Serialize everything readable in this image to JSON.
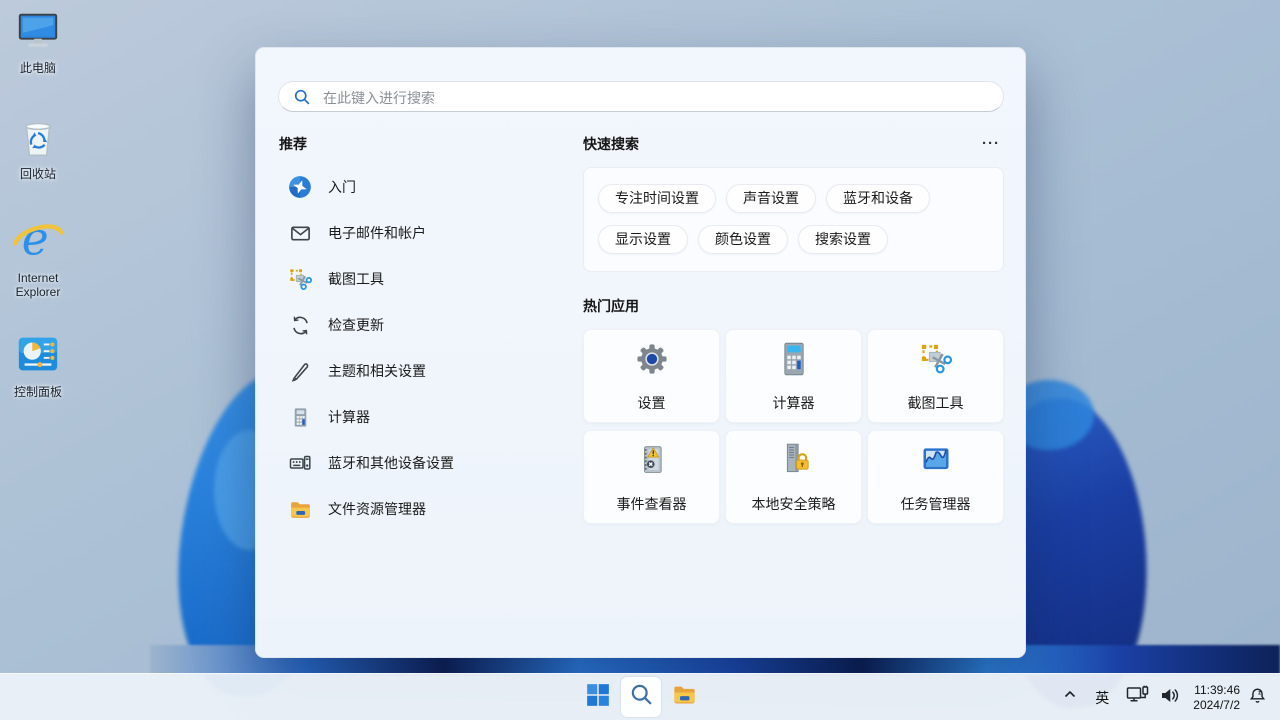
{
  "desktop": {
    "icons": [
      {
        "label": "此电脑",
        "icon": "this-pc-icon"
      },
      {
        "label": "回收站",
        "icon": "recycle-bin-icon"
      },
      {
        "label": "Internet Explorer",
        "icon": "internet-explorer-icon"
      },
      {
        "label": "控制面板",
        "icon": "control-panel-icon"
      }
    ]
  },
  "search_panel": {
    "search": {
      "placeholder": "在此键入进行搜索",
      "icon": "search-icon"
    },
    "recommended": {
      "title": "推荐",
      "items": [
        {
          "label": "入门",
          "icon": "get-started-icon"
        },
        {
          "label": "电子邮件和帐户",
          "icon": "email-icon"
        },
        {
          "label": "截图工具",
          "icon": "snipping-tool-icon"
        },
        {
          "label": "检查更新",
          "icon": "check-updates-icon"
        },
        {
          "label": "主题和相关设置",
          "icon": "themes-brush-icon"
        },
        {
          "label": "计算器",
          "icon": "calculator-icon"
        },
        {
          "label": "蓝牙和其他设备设置",
          "icon": "bluetooth-devices-icon"
        },
        {
          "label": "文件资源管理器",
          "icon": "file-explorer-icon"
        }
      ]
    },
    "quick_search": {
      "title": "快速搜索",
      "more_label": "···",
      "chips": [
        "专注时间设置",
        "声音设置",
        "蓝牙和设备",
        "显示设置",
        "颜色设置",
        "搜索设置"
      ]
    },
    "top_apps": {
      "title": "热门应用",
      "apps": [
        {
          "label": "设置",
          "icon": "settings-gear-icon"
        },
        {
          "label": "计算器",
          "icon": "calculator-icon"
        },
        {
          "label": "截图工具",
          "icon": "snipping-tool-icon"
        },
        {
          "label": "事件查看器",
          "icon": "event-viewer-icon"
        },
        {
          "label": "本地安全策略",
          "icon": "local-security-policy-icon"
        },
        {
          "label": "任务管理器",
          "icon": "task-manager-icon"
        }
      ]
    }
  },
  "taskbar": {
    "ime_indicator": "英",
    "clock": {
      "time": "11:39:46",
      "date": "2024/7/2"
    }
  },
  "colors": {
    "accent": "#2a7cd4",
    "panel_bg": "#f1f6fc",
    "taskbar_bg": "#e9eff7",
    "folder_yellow": "#f6c23a",
    "bloom_bright": "#2b83dd",
    "bloom_dark": "#1b3fa4"
  }
}
